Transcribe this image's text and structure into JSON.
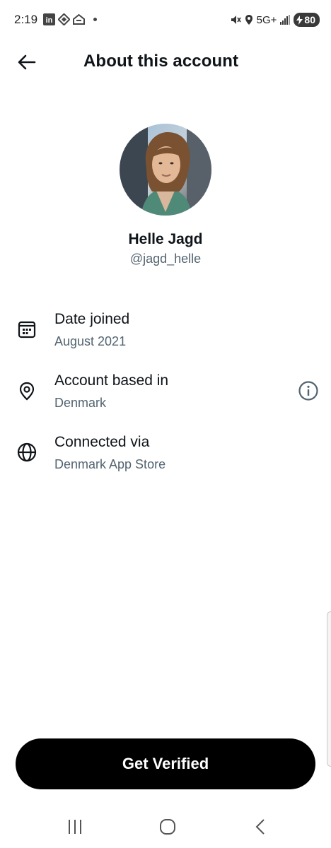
{
  "status_bar": {
    "time": "2:19",
    "linkedin_icon_text": "in",
    "network": "5G+",
    "battery": "80"
  },
  "header": {
    "title": "About this account"
  },
  "profile": {
    "name": "Helle Jagd",
    "handle": "@jagd_helle"
  },
  "details": [
    {
      "label": "Date joined",
      "value": "August 2021",
      "icon": "calendar-icon"
    },
    {
      "label": "Account based in",
      "value": "Denmark",
      "icon": "location-pin-icon",
      "extra_icon": "info-icon"
    },
    {
      "label": "Connected via",
      "value": "Denmark App Store",
      "icon": "globe-icon"
    }
  ],
  "cta": {
    "label": "Get Verified"
  },
  "colors": {
    "primary_text": "#0f1419",
    "secondary_text": "#536471",
    "button_bg": "#000000"
  }
}
